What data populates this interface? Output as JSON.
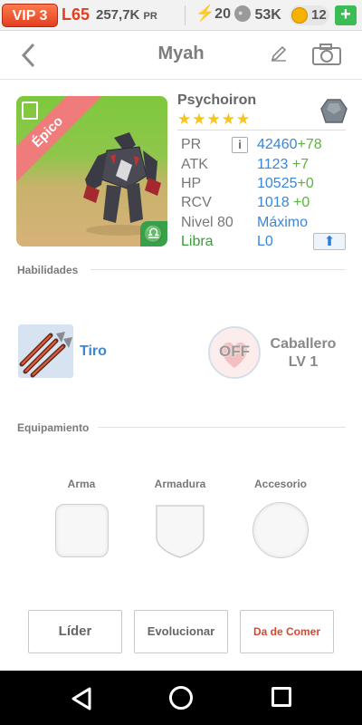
{
  "status_bar": {
    "vip": "VIP 3",
    "level": "L65",
    "power": "257,7K",
    "power_unit": "PR",
    "energy": "20",
    "food": "53K",
    "coins": "12",
    "add_label": "+"
  },
  "header": {
    "title": "Myah"
  },
  "monster": {
    "rarity": "Épico",
    "name": "Psychoiron",
    "stars": "★★★★★",
    "element": "Libra",
    "stats": [
      {
        "label": "PR",
        "value": "42460",
        "bonus": "+78"
      },
      {
        "label": "ATK",
        "value": "1123",
        "bonus": "+7"
      },
      {
        "label": "HP",
        "value": "10525",
        "bonus": "+0"
      },
      {
        "label": "RCV",
        "value": "1018",
        "bonus": "+0"
      }
    ],
    "level_label": "Nivel 80",
    "level_value": "Máximo",
    "rank": "L0",
    "info_label": "i"
  },
  "abilities": {
    "section_title": "Habilidades",
    "skill_name": "Tiro",
    "leader_state": "OFF",
    "leader_name": "Caballero",
    "leader_level": "LV 1"
  },
  "equipment": {
    "section_title": "Equipamiento",
    "slots": [
      "Arma",
      "Armadura",
      "Accesorio"
    ]
  },
  "actions": {
    "leader": "Líder",
    "evolve": "Evolucionar",
    "feed": "Da de Comer"
  },
  "colors": {
    "accent_blue": "#3b86d6",
    "bonus_green": "#59b63b",
    "vip_red": "#e23f1f",
    "epic_ribbon": "#f07b7b"
  }
}
